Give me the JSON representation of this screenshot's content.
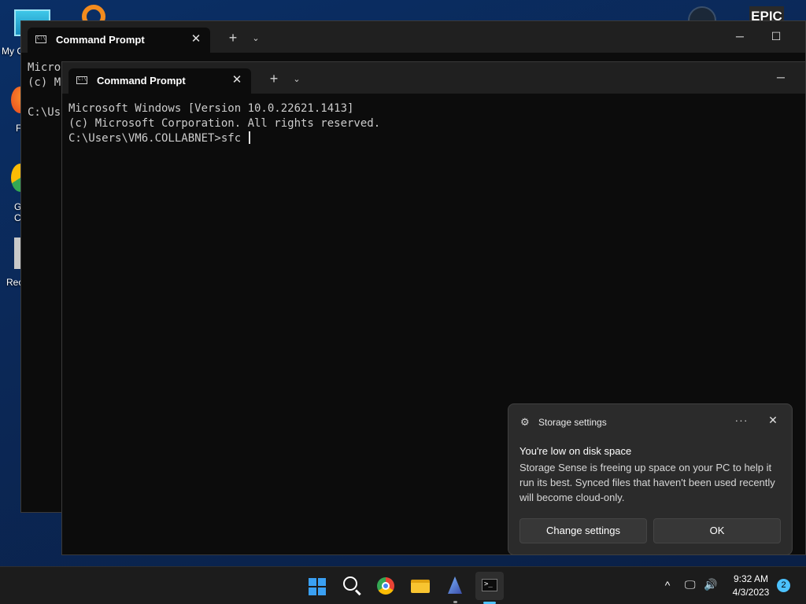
{
  "desktop": {
    "this_pc_label": "My C",
    "firefox_label": "F",
    "chrome_label": "G\nC",
    "recycle_label": "Rec",
    "epic_label": "EPIC"
  },
  "back_window": {
    "tab_title": "Command Prompt",
    "lines_partial": "Micro\n(c) M\n\nC:\\Us",
    "new_tab": "+",
    "dropdown": "⌄",
    "minimize": "─",
    "maximize": "☐"
  },
  "front_window": {
    "tab_title": "Command Prompt",
    "new_tab": "+",
    "dropdown": "⌄",
    "minimize": "─",
    "terminal_lines": [
      "Microsoft Windows [Version 10.0.22621.1413]",
      "(c) Microsoft Corporation. All rights reserved.",
      "",
      "C:\\Users\\VM6.COLLABNET>sfc "
    ]
  },
  "notification": {
    "app_name": "Storage settings",
    "more": "···",
    "close": "✕",
    "heading": "You're low on disk space",
    "body": "Storage Sense is freeing up space on your PC to help it run its best. Synced files that haven't been used recently will become cloud-only.",
    "change_settings": "Change settings",
    "ok": "OK"
  },
  "taskbar": {
    "tray_chevron": "^",
    "time": "9:32 AM",
    "date": "4/3/2023",
    "notification_count": "2"
  },
  "colors": {
    "accent": "#4cc2ff",
    "terminal_bg": "#0c0c0c",
    "titlebar_bg": "#202020"
  }
}
